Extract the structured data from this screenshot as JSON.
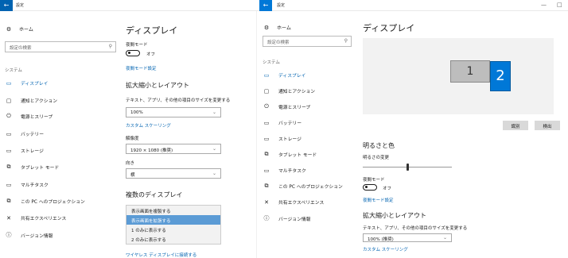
{
  "topbar": {
    "back_glyph": "←",
    "left_title": "設定",
    "right_title": "設定",
    "minimize_glyph": "—",
    "restore_glyph": "□"
  },
  "left_sidebar": {
    "home": "ホーム",
    "search_placeholder": "設定の検索",
    "section": "システム",
    "items": [
      "ディスプレイ",
      "通知とアクション",
      "電源とスリープ",
      "バッテリー",
      "ストレージ",
      "タブレット モード",
      "マルチタスク",
      "この PC へのプロジェクション",
      "共有エクスペリエンス",
      "バージョン情報"
    ]
  },
  "left_main": {
    "title": "ディスプレイ",
    "night_mode_label": "夜間モード",
    "night_mode_state": "オフ",
    "night_mode_settings": "夜間モード設定",
    "scale_heading": "拡大縮小とレイアウト",
    "scale_desc": "テキスト、アプリ、その他の項目のサイズを変更する",
    "scale_value": "100%",
    "custom_scaling": "カスタム スケーリング",
    "resolution_label": "解像度",
    "resolution_value": "1920 × 1080 (推奨)",
    "orientation_label": "向き",
    "orientation_value": "横",
    "multi_display_heading": "複数のディスプレイ",
    "multi_options": [
      "表示画面を複製する",
      "表示画面を拡張する",
      "1 のみに表示する",
      "2 のみに表示する"
    ],
    "multi_selected_index": 1,
    "wireless_link": "ワイヤレス ディスプレイに接続する"
  },
  "right_sidebar": {
    "home": "ホーム",
    "search_placeholder": "設定の検索",
    "section": "システム",
    "items": [
      "ディスプレイ",
      "通知とアクション",
      "電源とスリープ",
      "バッテリー",
      "ストレージ",
      "タブレット モード",
      "マルチタスク",
      "この PC へのプロジェクション",
      "共有エクスペリエンス",
      "バージョン情報"
    ]
  },
  "right_main": {
    "title": "ディスプレイ",
    "monitor_1": "1",
    "monitor_2": "2",
    "identify_button": "識別",
    "detect_button": "検出",
    "brightness_heading": "明るさと色",
    "brightness_label": "明るさの変更",
    "brightness_level": 0.5,
    "night_mode_label": "夜間モード",
    "night_mode_state": "オフ",
    "night_mode_settings": "夜間モード設定",
    "scale_heading": "拡大縮小とレイアウト",
    "scale_desc": "テキスト、アプリ、その他の項目のサイズを変更する",
    "scale_value": "100% (推奨)",
    "custom_scaling": "カスタム スケーリング"
  },
  "colors": {
    "accent": "#0063b1",
    "selected_option": "#5b9bd5",
    "monitor_active": "#0078d7"
  }
}
